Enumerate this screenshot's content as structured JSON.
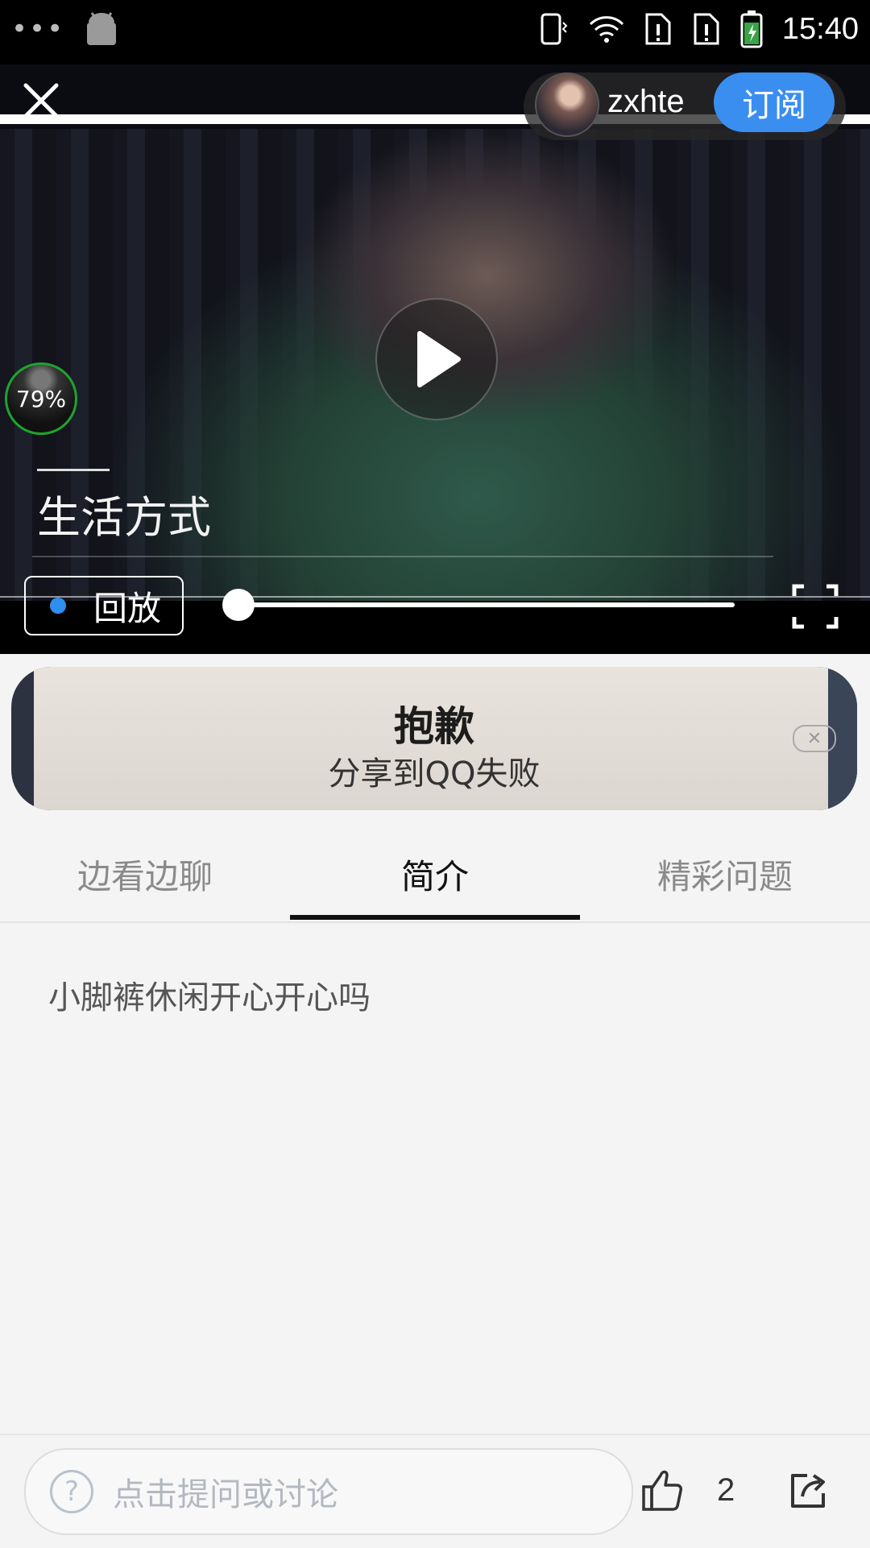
{
  "status_bar": {
    "time": "15:40",
    "icons": [
      "dots-icon",
      "android-icon",
      "phone-vibrate-icon",
      "wifi-icon",
      "sim1-alert-icon",
      "sim2-alert-icon",
      "battery-charging-icon"
    ]
  },
  "video": {
    "username": "zxhte",
    "subscribe_label": "订阅",
    "buffer_percent": "79%",
    "title": "生活方式",
    "replay_label": "回放",
    "progress_fraction": 0
  },
  "toast": {
    "title": "抱歉",
    "message": "分享到QQ失败"
  },
  "tabs": [
    {
      "label": "边看边聊",
      "active": false
    },
    {
      "label": "简介",
      "active": true
    },
    {
      "label": "精彩问题",
      "active": false
    }
  ],
  "description": "小脚裤休闲开心开心吗",
  "bottom_bar": {
    "input_placeholder": "点击提问或讨论",
    "like_count": "2"
  },
  "colors": {
    "accent": "#3a8ef0",
    "buffer_ring": "#1fa42c"
  }
}
